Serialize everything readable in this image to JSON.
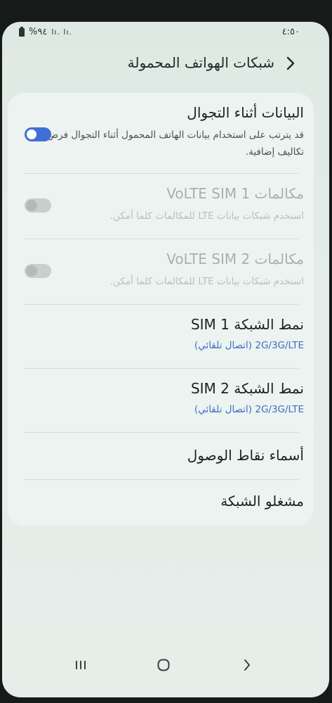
{
  "status_bar": {
    "battery": "%٩٤",
    "signal": "lı. lı.",
    "time": "٤:٥٠"
  },
  "app_bar": {
    "title": "شبكات الهواتف المحمولة"
  },
  "settings": {
    "roaming": {
      "title": "البيانات أثناء التجوال",
      "subtitle": "قد يترتب على استخدام بيانات الهاتف المحمول أثناء التجوال فرض تكاليف إضافية.",
      "enabled": true
    },
    "volte_sim1": {
      "title": "مكالمات VoLTE SIM 1",
      "subtitle": "استخدم شبكات بيانات LTE للمكالمات كلما أمكن.",
      "enabled": false
    },
    "volte_sim2": {
      "title": "مكالمات VoLTE SIM 2",
      "subtitle": "استخدم شبكات بيانات LTE للمكالمات كلما أمكن.",
      "enabled": false
    },
    "network_mode_sim1": {
      "title": "نمط الشبكة SIM 1",
      "value": "2G/3G/LTE (اتصال تلقائي)"
    },
    "network_mode_sim2": {
      "title": "نمط الشبكة SIM 2",
      "value": "2G/3G/LTE (اتصال تلقائي)"
    },
    "access_point_names": {
      "title": "أسماء نقاط الوصول"
    },
    "network_operators": {
      "title": "مشغلو الشبكة"
    }
  },
  "colors": {
    "accent": "#3f6fd6",
    "link_blue": "#3a6fc4",
    "background": "#e3ece8",
    "card": "#edf3f0"
  },
  "nav_icons": [
    "recent-apps-icon",
    "home-icon",
    "back-icon"
  ]
}
